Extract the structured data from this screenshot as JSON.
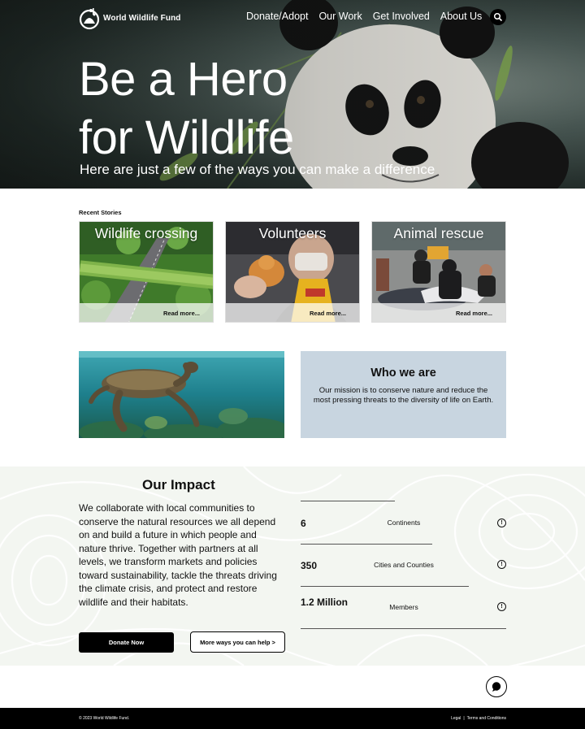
{
  "header": {
    "brand_name": "World Wildlife Fund",
    "nav": [
      "Donate/Adopt",
      "Our Work",
      "Get Involved",
      "About Us"
    ],
    "search_icon": "search-icon"
  },
  "hero": {
    "title_line1": "Be a Hero",
    "title_line2": "for Wildlife",
    "subtitle": "Here are just a few of the ways you can make a difference"
  },
  "stories": {
    "section_label": "Recent Stories",
    "items": [
      {
        "title": "Wildlife crossing",
        "link": "Read more..."
      },
      {
        "title": "Volunteers",
        "link": "Read more..."
      },
      {
        "title": "Animal rescue",
        "link": "Read more..."
      }
    ]
  },
  "who": {
    "title": "Who we are",
    "text": "Our mission is to conserve nature and reduce the most pressing threats to the diversity of life on Earth."
  },
  "impact": {
    "title": "Our Impact",
    "text": "We collaborate with local communities to conserve the natural resources we all depend on and build a future in which people and nature thrive. Together with partners at all levels, we transform markets and policies toward sustainability, tackle the threats driving the climate crisis, and protect and restore wildlife and their habitats.",
    "donate_button": "Donate Now",
    "more_button": "More ways you can help >",
    "stats": [
      {
        "value": "6",
        "label": "Continents",
        "progress": 0.46
      },
      {
        "value": "350",
        "label": "Cities and Counties",
        "progress": 0.64
      },
      {
        "value": "1.2 Million",
        "label": "Members",
        "progress": 0.82
      }
    ]
  },
  "footer": {
    "copyright": "© 2023 World Wildlife Fund.",
    "legal": "Legal",
    "separator": "|",
    "terms": "Terms and Conditions"
  },
  "colors": {
    "who_bg": "#c8d5e0",
    "impact_bg": "#f3f6f1",
    "footer_bg": "#000000"
  }
}
